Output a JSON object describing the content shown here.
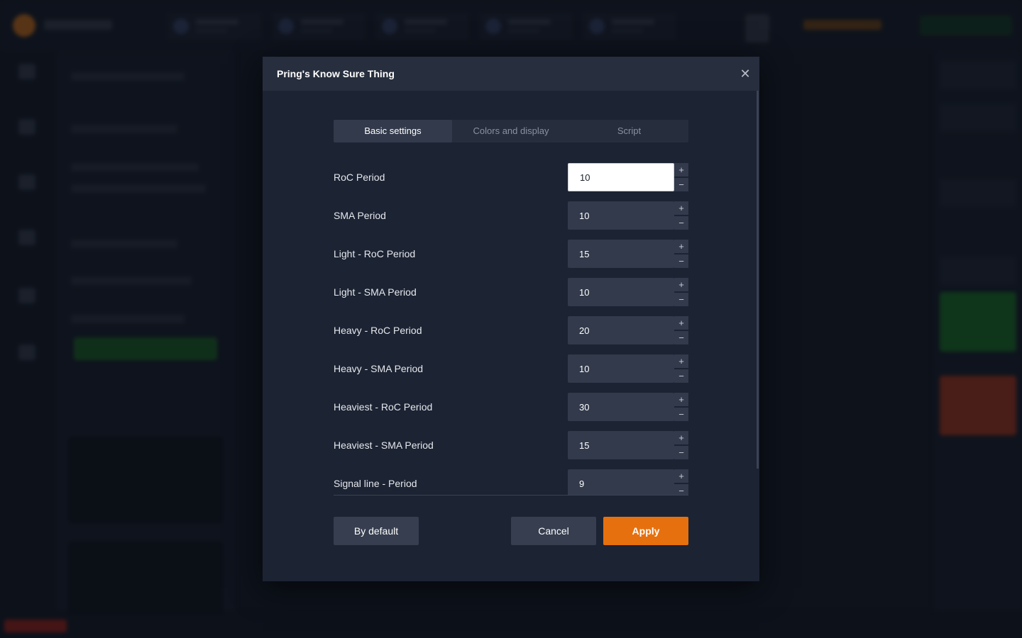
{
  "dialog": {
    "title": "Pring's Know Sure Thing",
    "close_icon": "close-icon",
    "close_glyph": "✕"
  },
  "tabs": [
    {
      "label": "Basic settings",
      "active": true
    },
    {
      "label": "Colors and display",
      "active": false
    },
    {
      "label": "Script",
      "active": false
    }
  ],
  "settings": [
    {
      "label": "RoC Period",
      "value": "10",
      "focused": true
    },
    {
      "label": "SMA Period",
      "value": "10"
    },
    {
      "label": "Light - RoC Period",
      "value": "15"
    },
    {
      "label": "Light - SMA Period",
      "value": "10"
    },
    {
      "label": "Heavy - RoC Period",
      "value": "20"
    },
    {
      "label": "Heavy - SMA Period",
      "value": "10"
    },
    {
      "label": "Heaviest - RoC Period",
      "value": "30"
    },
    {
      "label": "Heaviest - SMA Period",
      "value": "15"
    },
    {
      "label": "Signal line - Period",
      "value": "9"
    }
  ],
  "stepper": {
    "plus": "+",
    "minus": "−"
  },
  "buttons": {
    "by_default": "By default",
    "cancel": "Cancel",
    "apply": "Apply"
  },
  "colors": {
    "accent": "#e7700e",
    "dialog_bg": "#1c2333"
  }
}
